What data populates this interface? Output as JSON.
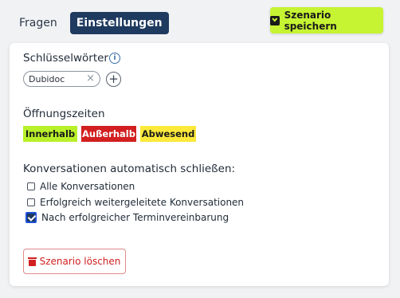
{
  "tabs": [
    {
      "label": "Fragen",
      "active": false
    },
    {
      "label": "Einstellungen",
      "active": true
    }
  ],
  "header": {
    "save_label": "Szenario speichern",
    "save_icon": "download-icon"
  },
  "keywords": {
    "label": "Schlüsselwörter",
    "info_icon": "info-icon",
    "chips": [
      "Dubidoc"
    ],
    "remove_icon": "×",
    "add_icon": "+"
  },
  "opening_hours": {
    "label": "Öffnungszeiten",
    "options": [
      "Innerhalb",
      "Außerhalb",
      "Abwesend"
    ]
  },
  "auto_close": {
    "label": "Konversationen automatisch schließen:",
    "options": [
      {
        "label": "Alle Konversationen",
        "checked": false
      },
      {
        "label": "Erfolgreich weitergeleitete Konversationen",
        "checked": false
      },
      {
        "label": "Nach erfolgreicher Terminvereinbarung",
        "checked": true
      }
    ]
  },
  "delete": {
    "label": "Szenario löschen",
    "icon": "trash-icon"
  },
  "colors": {
    "accent": "#c6f432",
    "navy": "#1e3a5f",
    "inside": "#b8f02a",
    "outside": "#d21f1f",
    "away": "#fde93a"
  }
}
